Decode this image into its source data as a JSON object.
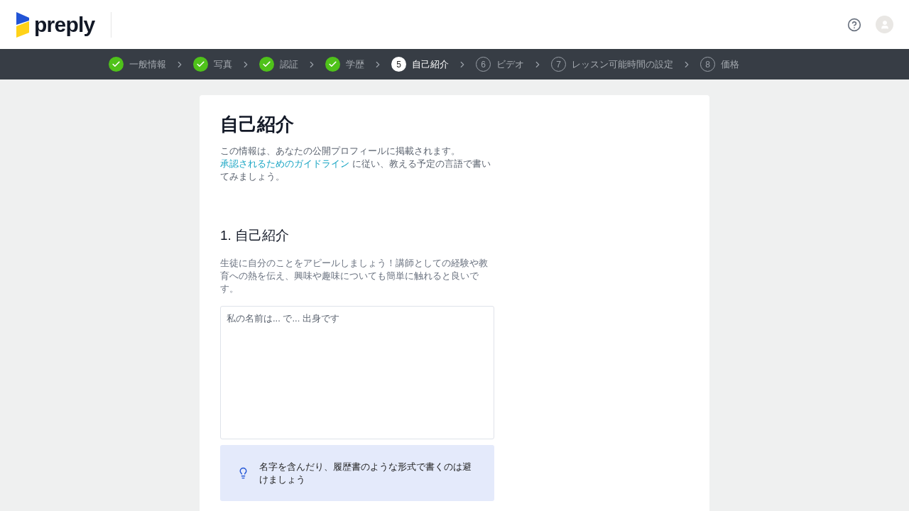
{
  "header": {
    "logo": "preply"
  },
  "steps": [
    {
      "label": "一般情報",
      "kind": "done"
    },
    {
      "label": "写真",
      "kind": "done"
    },
    {
      "label": "認証",
      "kind": "done"
    },
    {
      "label": "学歴",
      "kind": "done"
    },
    {
      "label": "自己紹介",
      "kind": "current",
      "number": "5"
    },
    {
      "label": "ビデオ",
      "kind": "upcoming",
      "number": "6"
    },
    {
      "label": "レッスン可能時間の設定",
      "kind": "upcoming",
      "number": "7"
    },
    {
      "label": "価格",
      "kind": "upcoming",
      "number": "8"
    }
  ],
  "page": {
    "title": "自己紹介",
    "intro_text": "この情報は、あなたの公開プロフィールに掲載されます。",
    "intro_link": "承認されるためのガイドライン",
    "intro_rest": " に従い、教える予定の言語で書いてみましょう。"
  },
  "section": {
    "heading": "1. 自己紹介",
    "description": "生徒に自分のことをアピールしましょう！講師としての経験や教育への熱を伝え、興味や趣味についても簡単に触れると良いです。",
    "placeholder": "私の名前は... で... 出身です",
    "tip": "名字を含んだり、履歴書のような形式で書くのは避けましょう"
  }
}
